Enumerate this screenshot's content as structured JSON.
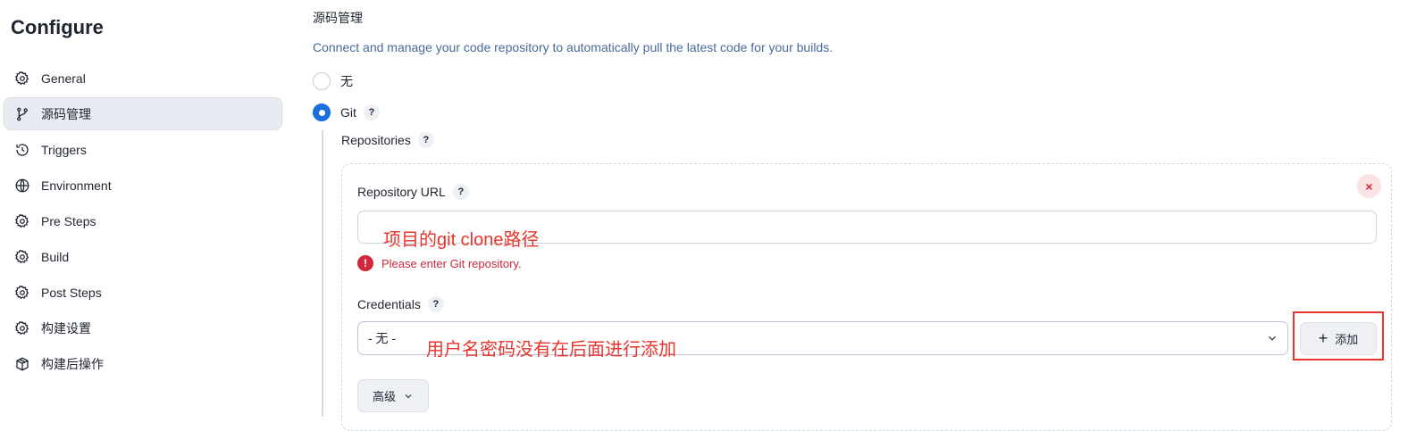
{
  "sidebar": {
    "title": "Configure",
    "items": [
      {
        "label": "General",
        "icon": "gear-icon"
      },
      {
        "label": "源码管理",
        "icon": "git-branch-icon"
      },
      {
        "label": "Triggers",
        "icon": "clock-icon"
      },
      {
        "label": "Environment",
        "icon": "globe-icon"
      },
      {
        "label": "Pre Steps",
        "icon": "gear-icon"
      },
      {
        "label": "Build",
        "icon": "gear-icon"
      },
      {
        "label": "Post Steps",
        "icon": "gear-icon"
      },
      {
        "label": "构建设置",
        "icon": "gear-icon"
      },
      {
        "label": "构建后操作",
        "icon": "box-icon"
      }
    ],
    "active_index": 1
  },
  "scm": {
    "title": "源码管理",
    "description": "Connect and manage your code repository to automatically pull the latest code for your builds.",
    "option_none": "无",
    "option_git": "Git",
    "help": "?",
    "repositories_label": "Repositories",
    "repo": {
      "remove": "×",
      "url_label": "Repository URL",
      "url_value": "",
      "url_annotation": "项目的git clone路径",
      "error_icon": "!",
      "error": "Please enter Git repository.",
      "credentials_label": "Credentials",
      "credentials_selected": "- 无 -",
      "credentials_annotation": "用户名密码没有在后面进行添加",
      "add_plus": "+",
      "add_label": "添加",
      "advanced_label": "高级"
    }
  },
  "colors": {
    "accent": "#1a6fe0",
    "error": "#d0283a",
    "annotation": "#e8352d",
    "description": "#4a6a98"
  }
}
